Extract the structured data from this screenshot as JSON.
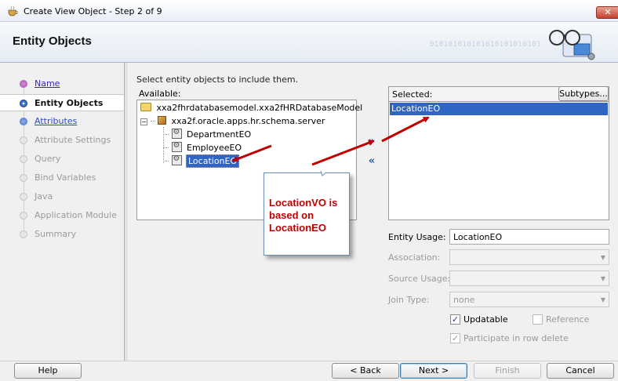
{
  "window": {
    "title": "Create View Object - Step 2 of 9",
    "close_label": "✕"
  },
  "header": {
    "title": "Entity Objects",
    "binary_decoration": "010101010101010101010101"
  },
  "nav": {
    "items": [
      {
        "label": "Name",
        "state": "link"
      },
      {
        "label": "Entity Objects",
        "state": "current"
      },
      {
        "label": "Attributes",
        "state": "link"
      },
      {
        "label": "Attribute Settings",
        "state": "disabled"
      },
      {
        "label": "Query",
        "state": "disabled"
      },
      {
        "label": "Bind Variables",
        "state": "disabled"
      },
      {
        "label": "Java",
        "state": "disabled"
      },
      {
        "label": "Application Module",
        "state": "disabled"
      },
      {
        "label": "Summary",
        "state": "disabled"
      }
    ]
  },
  "main": {
    "instruction": "Select entity objects to include them.",
    "available": {
      "label": "Available:",
      "tree": [
        {
          "label": "xxa2fhrdatabasemodel.xxa2fHRDatabaseModel",
          "icon": "folder-icon",
          "level": 0
        },
        {
          "label": "xxa2f.oracle.apps.hr.schema.server",
          "icon": "package-icon",
          "level": 1
        },
        {
          "label": "DepartmentEO",
          "icon": "entity-object-icon",
          "level": 2
        },
        {
          "label": "EmployeeEO",
          "icon": "entity-object-icon",
          "level": 2
        },
        {
          "label": "LocationEO",
          "icon": "entity-object-icon",
          "level": 2,
          "selected": true
        }
      ]
    },
    "shuttle": {
      "add_label": "»",
      "remove_label": "«"
    },
    "selected": {
      "label": "Selected:",
      "subtypes_label": "Subtypes...",
      "items": [
        "LocationEO"
      ]
    },
    "form": {
      "entity_usage_label": "Entity Usage:",
      "entity_usage_value": "LocationEO",
      "association_label": "Association:",
      "association_value": "",
      "source_usage_label": "Source Usage:",
      "source_usage_value": "",
      "join_type_label": "Join Type:",
      "join_type_value": "none",
      "updatable_label": "Updatable",
      "updatable_checked": true,
      "reference_label": "Reference",
      "reference_checked": false,
      "participate_label": "Participate in row delete",
      "participate_checked": true
    },
    "callout": {
      "text": "LocationVO is based on LocationEO"
    }
  },
  "footer": {
    "help_label": "Help",
    "back_label": "< Back",
    "next_label": "Next >",
    "finish_label": "Finish",
    "cancel_label": "Cancel"
  },
  "colors": {
    "selection_blue": "#3165c5",
    "link_blue": "#2a4fb0",
    "annotation_red": "#c00000",
    "header_bg": "#e9eef6"
  }
}
